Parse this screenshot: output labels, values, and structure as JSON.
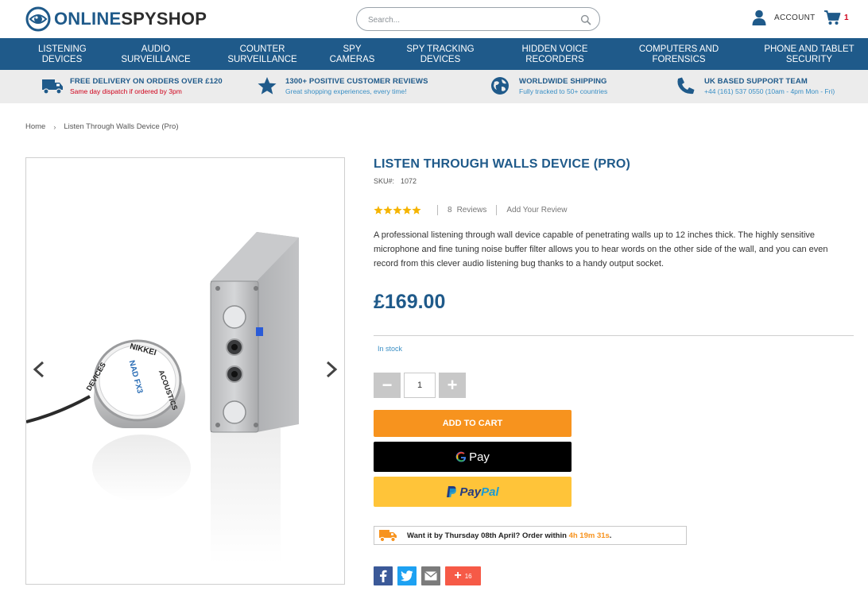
{
  "header": {
    "logo_part1": "ONLINE",
    "logo_part2": "SPYSHOP",
    "search_placeholder": "Search...",
    "account_label": "ACCOUNT",
    "cart_count": "1"
  },
  "nav": {
    "items": [
      {
        "line1": "LISTENING",
        "line2": "DEVICES"
      },
      {
        "line1": "AUDIO",
        "line2": "SURVEILLANCE"
      },
      {
        "line1": "COUNTER",
        "line2": "SURVEILLANCE"
      },
      {
        "line1": "SPY",
        "line2": "CAMERAS"
      },
      {
        "line1": "SPY TRACKING",
        "line2": "DEVICES"
      },
      {
        "line1": "HIDDEN VOICE",
        "line2": "RECORDERS"
      },
      {
        "line1": "COMPUTERS AND",
        "line2": "FORENSICS"
      },
      {
        "line1": "PHONE AND TABLET",
        "line2": "SECURITY"
      }
    ]
  },
  "benefits": [
    {
      "title": "FREE DELIVERY ON ORDERS OVER £120",
      "subtitle": "Same day dispatch if ordered by 3pm",
      "icon": "truck-icon",
      "subtitle_color": "#d0021b"
    },
    {
      "title": "1300+ POSITIVE CUSTOMER REVIEWS",
      "subtitle": "Great shopping experiences, every time!",
      "icon": "star-icon",
      "subtitle_color": "#3a8fc5"
    },
    {
      "title": "WORLDWIDE SHIPPING",
      "subtitle": "Fully tracked to 50+ countries",
      "icon": "globe-icon",
      "subtitle_color": "#3a8fc5"
    },
    {
      "title": "UK BASED SUPPORT TEAM",
      "subtitle": "+44 (161) 537 0550 (10am - 4pm Mon - Fri)",
      "icon": "phone-icon",
      "subtitle_color": "#3a8fc5"
    }
  ],
  "breadcrumb": {
    "home": "Home",
    "current": "Listen Through Walls Device (Pro)"
  },
  "gallery": {
    "mic_text_top": "NIKKEI",
    "mic_text_right": "ACOUSTICS",
    "mic_text_left": "DEVICES",
    "mic_text_center": "NAD FX3"
  },
  "product": {
    "title": "LISTEN THROUGH WALLS DEVICE (PRO)",
    "sku_label": "SKU#:",
    "sku": "1072",
    "rating": 5,
    "review_count": "8",
    "reviews_label": "Reviews",
    "add_review": "Add Your Review",
    "description": "A professional listening through wall device capable of penetrating walls up to 12 inches thick.  The highly sensitive microphone and fine tuning noise buffer filter allows you to hear words on the other side of the wall, and you can even record from this clever audio listening bug thanks to a handy output socket.",
    "price": "£169.00",
    "stock": "In stock",
    "quantity": "1",
    "minus": "−",
    "plus": "+",
    "add_to_cart": "ADD TO CART",
    "gpay_label": "Pay",
    "paypal_p": "Pay",
    "paypal_pal": "Pal",
    "delivery_prefix": "Want it by Thursday 08th April? Order within ",
    "delivery_countdown": "4h 19m 31s",
    "delivery_suffix": ".",
    "share_count": "16"
  },
  "colors": {
    "brand_blue": "#1f5a8a",
    "accent_orange": "#f7931e",
    "gpay_black": "#000000",
    "paypal_yellow": "#ffc439"
  }
}
